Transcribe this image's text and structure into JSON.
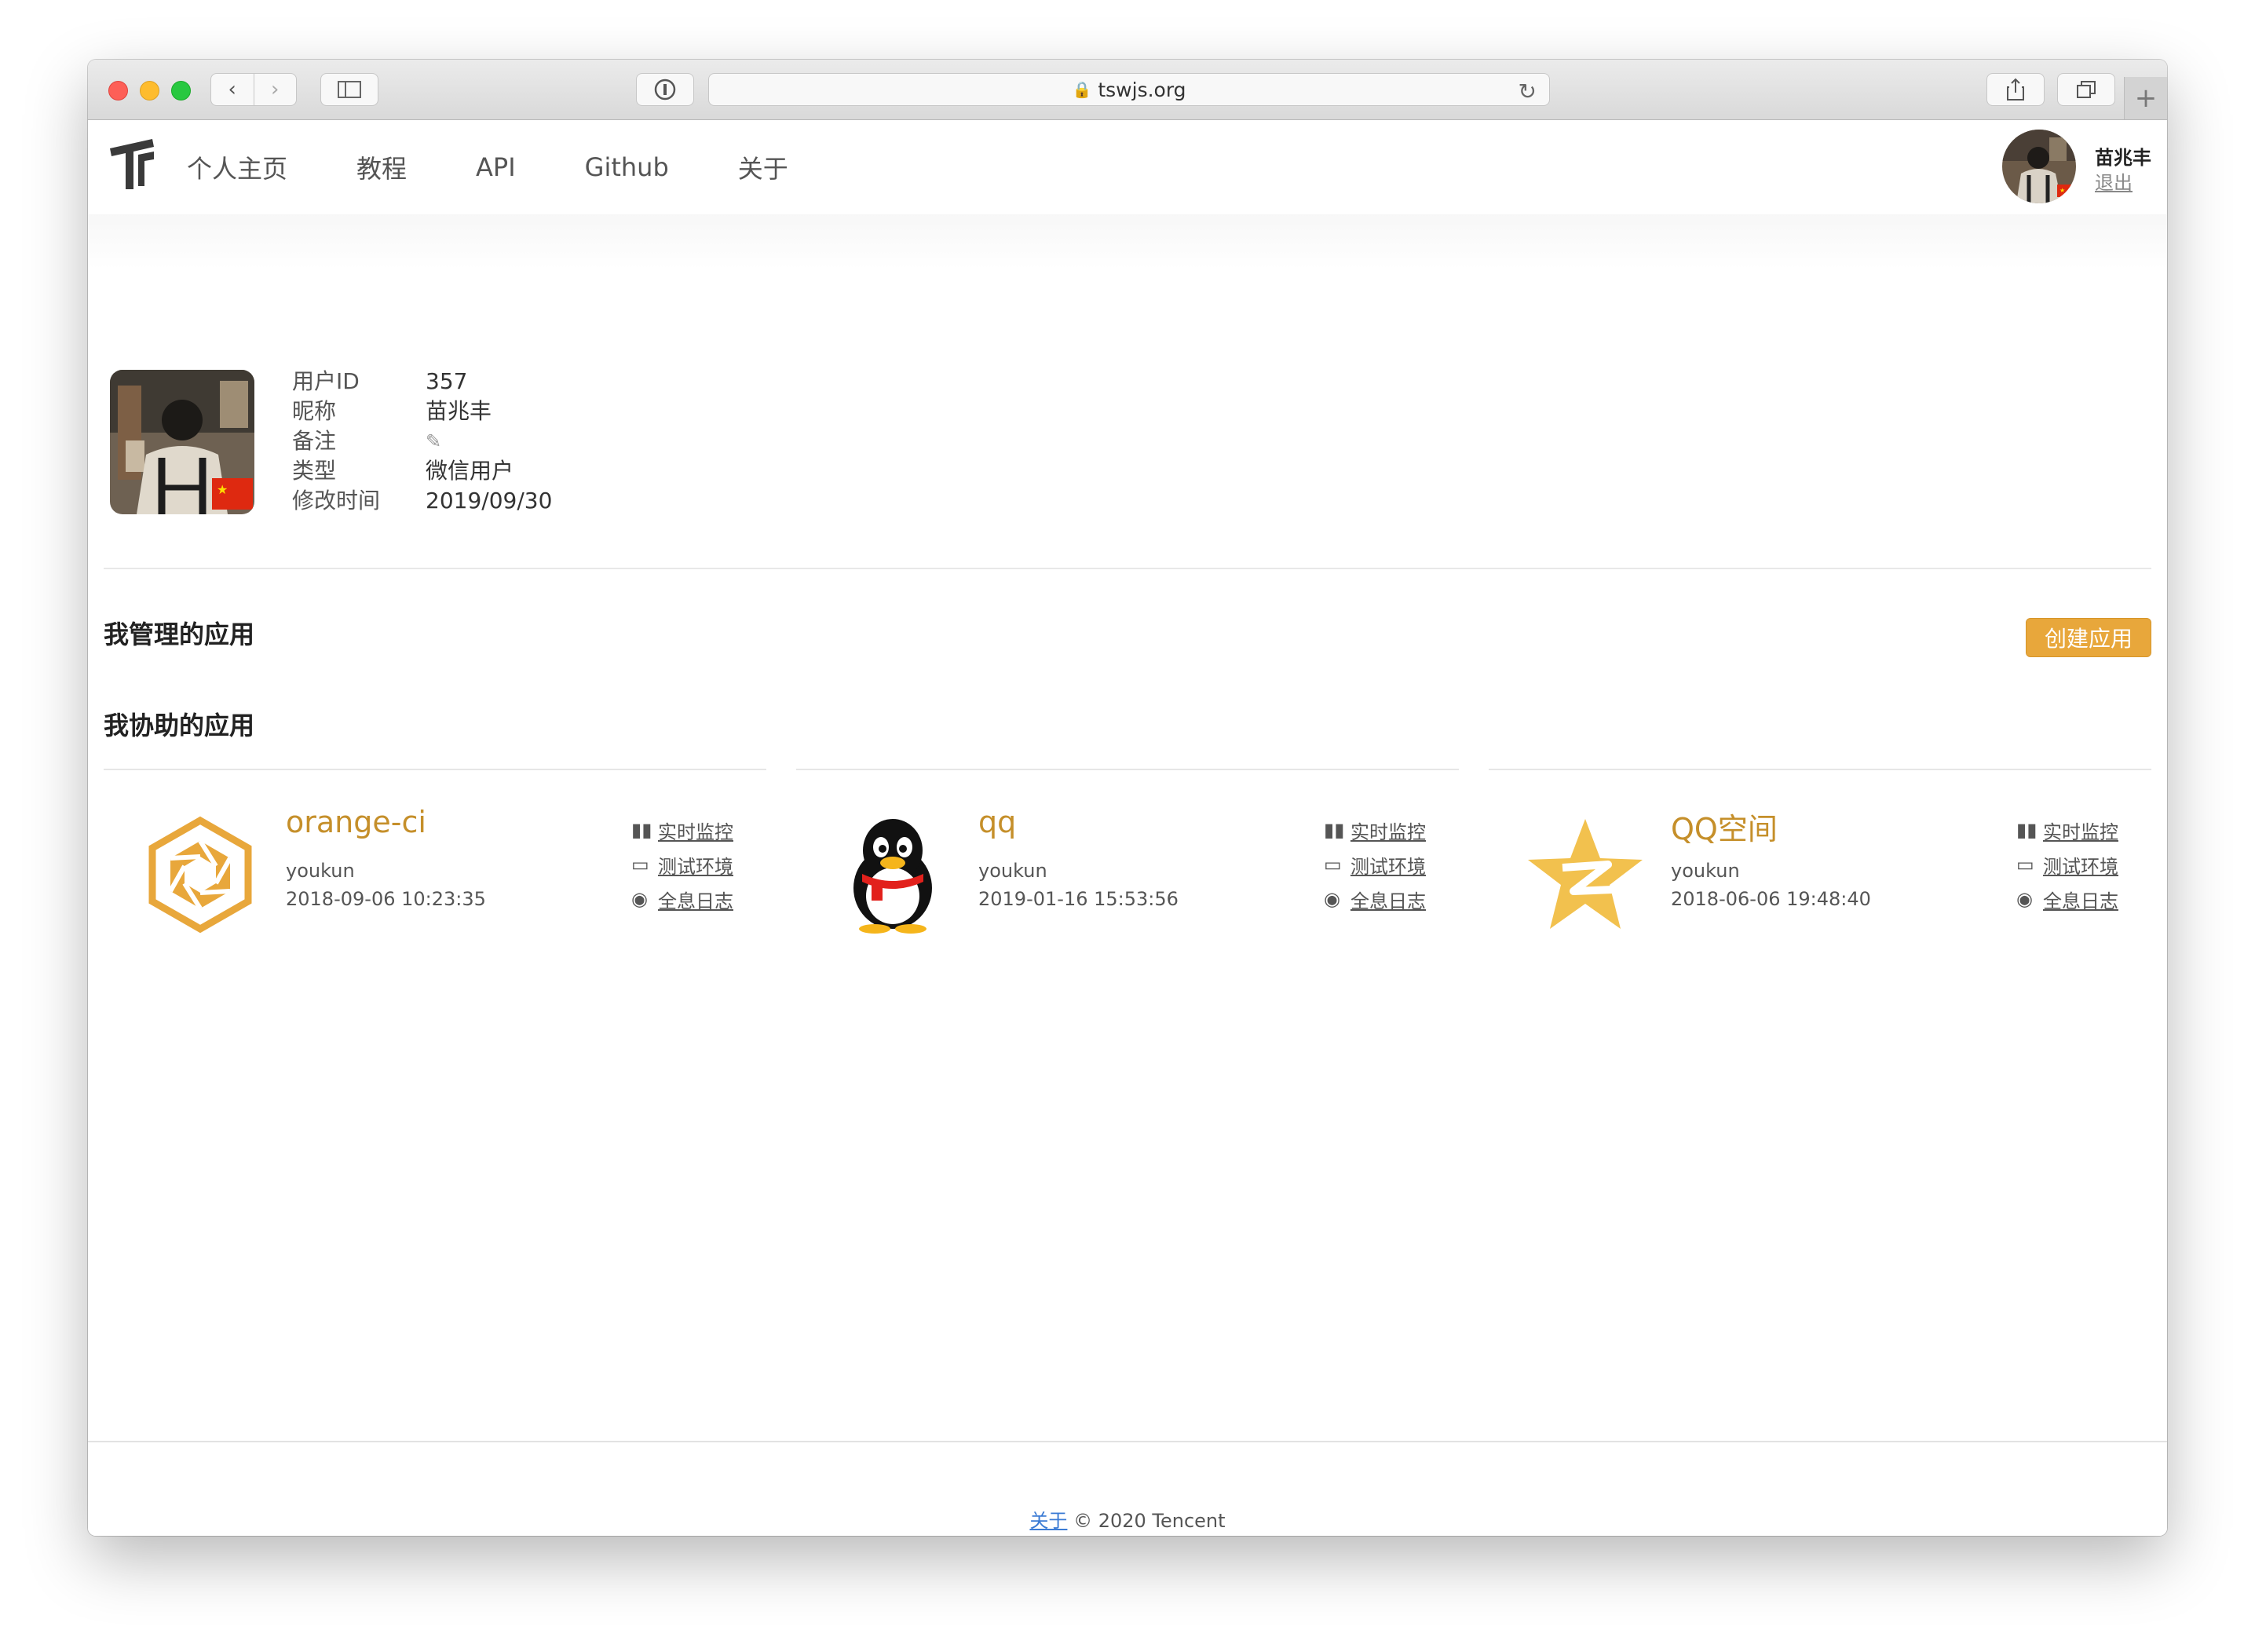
{
  "browser": {
    "url": "tswjs.org",
    "back_icon": "chevron-left",
    "forward_icon": "chevron-right",
    "new_tab_label": "+"
  },
  "nav": {
    "items": [
      "个人主页",
      "教程",
      "API",
      "Github",
      "关于"
    ],
    "user_name": "苗兆丰",
    "logout": "退出"
  },
  "profile": {
    "rows": [
      {
        "label": "用户ID",
        "value": "357"
      },
      {
        "label": "昵称",
        "value": "苗兆丰"
      },
      {
        "label": "备注",
        "value": "✎"
      },
      {
        "label": "类型",
        "value": "微信用户"
      },
      {
        "label": "修改时间",
        "value": "2019/09/30"
      }
    ]
  },
  "sections": {
    "managed_title": "我管理的应用",
    "create_button": "创建应用",
    "assisted_title": "我协助的应用"
  },
  "apps": [
    {
      "name": "orange-ci",
      "owner": "youkun",
      "date": "2018-09-06 10:23:35",
      "icon": "orange-ci-hexagon-icon"
    },
    {
      "name": "qq",
      "owner": "youkun",
      "date": "2019-01-16 15:53:56",
      "icon": "qq-penguin-icon"
    },
    {
      "name": "QQ空间",
      "owner": "youkun",
      "date": "2018-06-06 19:48:40",
      "icon": "qzone-star-icon"
    }
  ],
  "app_links": [
    "实时监控",
    "测试环境",
    "全息日志"
  ],
  "footer": {
    "link": "关于",
    "text": "© 2020 Tencent"
  },
  "colors": {
    "accent": "#e8a73b",
    "app_title": "#c58f2a",
    "link_blue": "#3b7bd4"
  }
}
